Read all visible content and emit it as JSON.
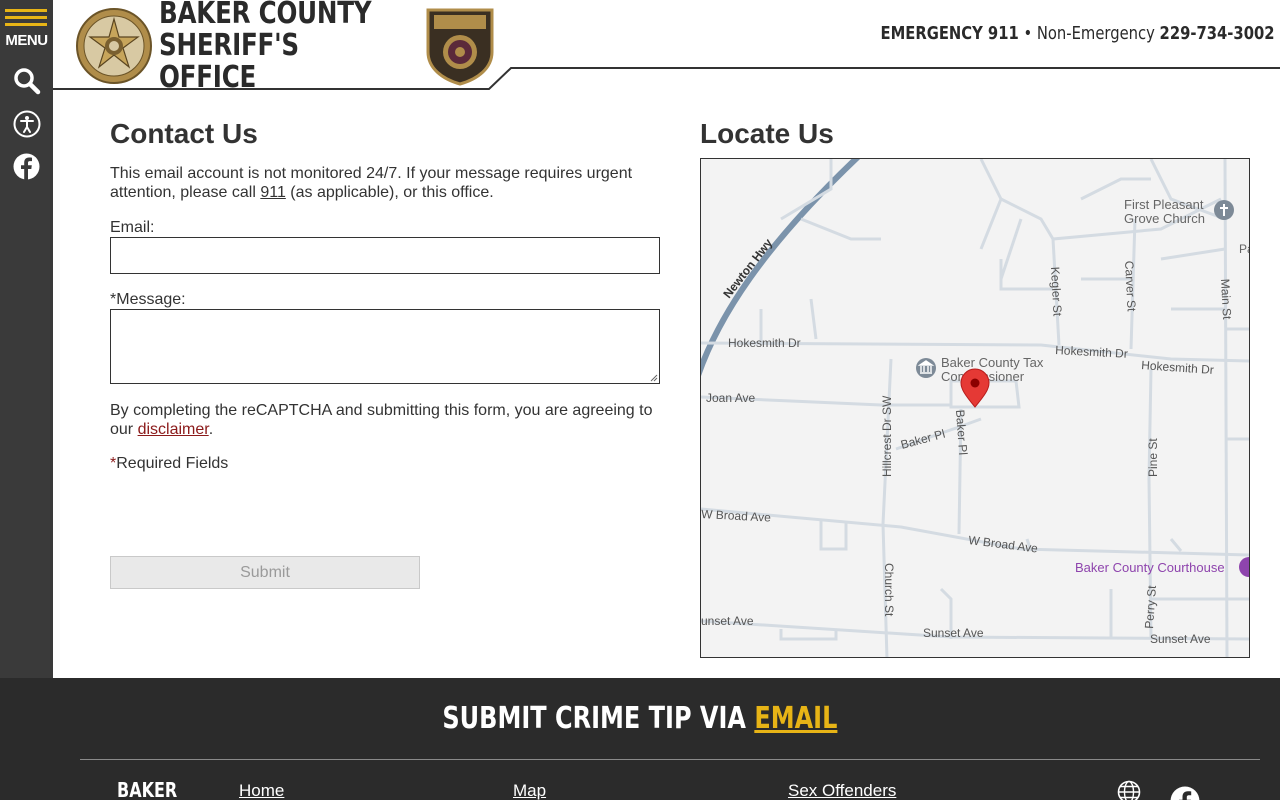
{
  "sidebar": {
    "menu_label": "MENU"
  },
  "header": {
    "title_line1": "BAKER COUNTY",
    "title_line2": "SHERIFF'S OFFICE",
    "emergency_label": "EMERGENCY 911",
    "separator": "•",
    "non_emergency_label": "Non-Emergency",
    "non_emergency_number": "229-734-3002"
  },
  "contact": {
    "title": "Contact Us",
    "notice_text": "This email account is not monitored 24/7. If your message requires urgent attention, please call",
    "notice_link": "911",
    "notice_suffix": "(as applicable), or this office.",
    "email_label": "Email:",
    "email_value": "",
    "message_required_mark": "*",
    "message_label": "Message:",
    "message_value": "",
    "agreement_text": "By completing the reCAPTCHA and submitting this form, you are agreeing to our",
    "agreement_link": "disclaimer",
    "agreement_suffix": ".",
    "required_mark": "*",
    "required_text": "Required Fields",
    "submit_label": "Submit"
  },
  "locate": {
    "title": "Locate Us",
    "map_labels": {
      "newton_hwy": "Newton Hwy",
      "hokesmith_dr_w": "Hokesmith Dr",
      "hokesmith_dr_e1": "Hokesmith Dr",
      "hokesmith_dr_e2": "Hokesmith Dr",
      "joan_ave": "Joan Ave",
      "kegler_st": "Kegler St",
      "carver_st": "Carver St",
      "main_st": "Main St",
      "hillcrest_dr_sw": "Hillcrest Dr SW",
      "baker_pl_1": "Baker Pl",
      "baker_pl_2": "Baker Pl",
      "pine_st": "Pine St",
      "w_broad_ave_1": "W Broad Ave",
      "w_broad_ave_2": "W Broad Ave",
      "church_st": "Church St",
      "perry_st": "Perry St",
      "sunset_ave_1": "unset Ave",
      "sunset_ave_2": "Sunset Ave",
      "sunset_ave_3": "Sunset Ave",
      "first_pleasant_1": "First Pleasant",
      "first_pleasant_2": "Grove Church",
      "tax_comm_1": "Baker County Tax",
      "tax_comm_2": "Commissioner",
      "courthouse": "Baker County Courthouse",
      "pa_cut": "Pa"
    }
  },
  "footer": {
    "tip_prefix": "SUBMIT CRIME TIP VIA",
    "tip_link": "EMAIL",
    "brand": "BAKER",
    "links": [
      "Home",
      "Map",
      "Sex Offenders"
    ]
  },
  "colors": {
    "accent": "#e7b416",
    "sidebar": "#3a3a3a",
    "footer": "#2b2b2b",
    "link_red": "#8b1a1a",
    "map_marker": "#e53935",
    "map_poi_purple": "#8e44ad"
  }
}
